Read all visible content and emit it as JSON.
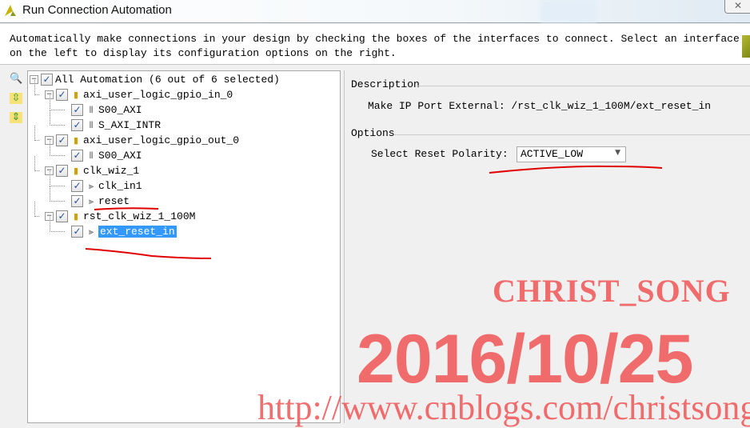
{
  "window": {
    "title": "Run Connection Automation",
    "close_icon": "close-x"
  },
  "description": "Automatically make connections in your design by checking the boxes of the interfaces to connect. Select an interface on the left to display its configuration options on the right.",
  "toolbar": {
    "icons": [
      "search-icon",
      "expand-all-icon",
      "collapse-all-icon"
    ]
  },
  "tree": [
    {
      "label": "All Automation (6 out of 6 selected)",
      "level": 0,
      "checked": true,
      "expandable": true,
      "icon": ""
    },
    {
      "label": "axi_user_logic_gpio_in_0",
      "level": 1,
      "checked": true,
      "expandable": true,
      "icon": "ip"
    },
    {
      "label": "S00_AXI",
      "level": 2,
      "checked": true,
      "icon": "bus"
    },
    {
      "label": "S_AXI_INTR",
      "level": 2,
      "checked": true,
      "icon": "bus"
    },
    {
      "label": "axi_user_logic_gpio_out_0",
      "level": 1,
      "checked": true,
      "expandable": true,
      "icon": "ip"
    },
    {
      "label": "S00_AXI",
      "level": 2,
      "checked": true,
      "icon": "bus"
    },
    {
      "label": "clk_wiz_1",
      "level": 1,
      "checked": true,
      "expandable": true,
      "icon": "ip"
    },
    {
      "label": "clk_in1",
      "level": 2,
      "checked": true,
      "icon": "pin"
    },
    {
      "label": "reset",
      "level": 2,
      "checked": true,
      "icon": "pin"
    },
    {
      "label": "rst_clk_wiz_1_100M",
      "level": 1,
      "checked": true,
      "expandable": true,
      "icon": "ip"
    },
    {
      "label": "ext_reset_in",
      "level": 2,
      "checked": true,
      "icon": "pin",
      "selected": true
    }
  ],
  "details": {
    "description_header": "Description",
    "description_text": "Make IP Port External: /rst_clk_wiz_1_100M/ext_reset_in",
    "options_header": "Options",
    "reset_polarity_label": "Select Reset Polarity:",
    "reset_polarity_value": "ACTIVE_LOW"
  },
  "watermark": {
    "name": "CHRIST_SONG",
    "date": "2016/10/25",
    "url": "http://www.cnblogs.com/christsong/"
  },
  "colors": {
    "selection": "#3399ff",
    "watermark": "#f04a4a",
    "annotation": "#e00000"
  }
}
